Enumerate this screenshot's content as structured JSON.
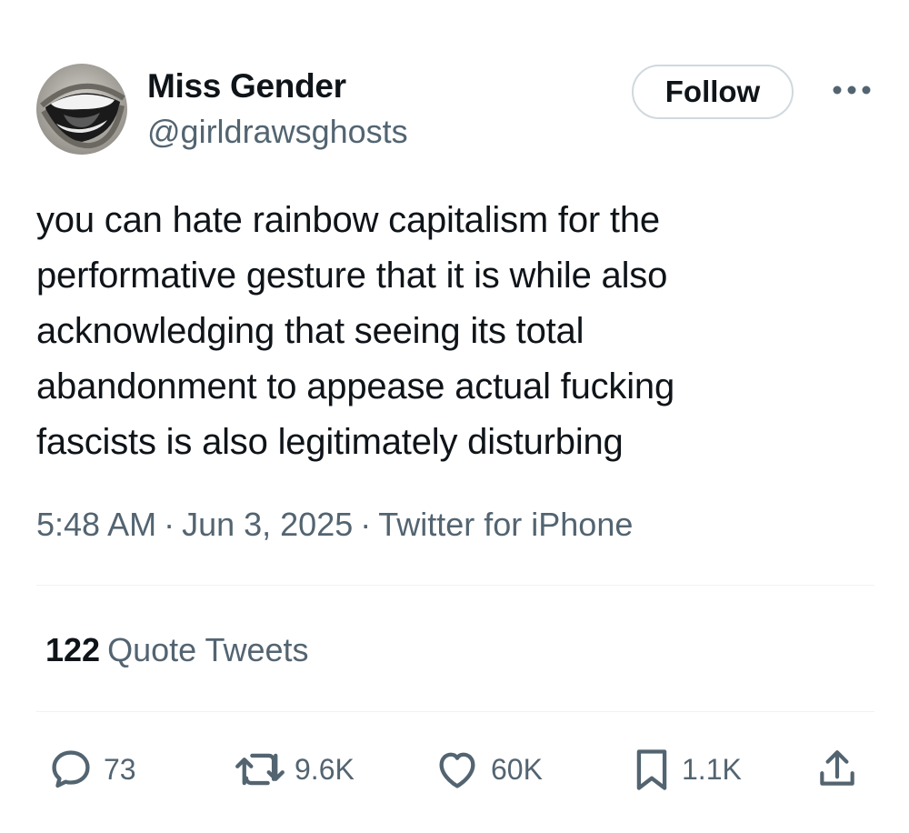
{
  "user": {
    "name": "Miss Gender",
    "handle": "@girldrawsghosts"
  },
  "follow_label": "Follow",
  "tweet": {
    "lines": [
      "you can hate rainbow capitalism for the",
      "performative gesture that it is while also",
      "acknowledging that seeing its total",
      "abandonment to appease actual fucking",
      "fascists is also legitimately disturbing"
    ],
    "time": "5:48 AM",
    "date": "Jun 3, 2025",
    "source": "Twitter for iPhone",
    "separator": "·"
  },
  "stats": {
    "quote_count": "122",
    "quote_label": "Quote Tweets"
  },
  "actions": {
    "replies": "73",
    "retweets": "9.6K",
    "likes": "60K",
    "bookmarks": "1.1K"
  },
  "icons": {
    "reply": "reply-icon",
    "retweet": "retweet-icon",
    "like": "heart-icon",
    "bookmark": "bookmark-icon",
    "share": "share-icon",
    "more": "more-icon"
  },
  "colors": {
    "text": "#0f1419",
    "secondary": "#536471",
    "border": "#cfd9de",
    "divider": "#eff3f4"
  }
}
